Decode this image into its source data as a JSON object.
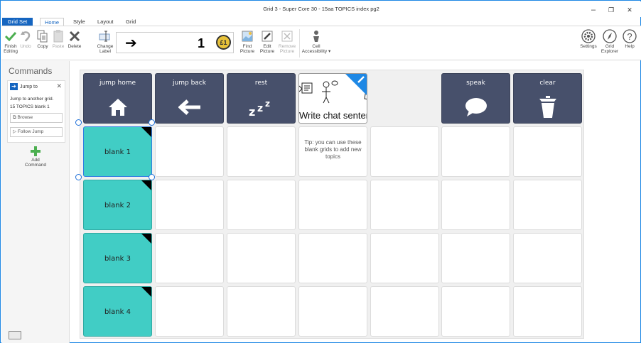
{
  "window": {
    "title": "Grid 3 - Super Core 30 - 15aa TOPICS index pg2",
    "minimize": "–",
    "maximize": "❐",
    "close": "✕"
  },
  "tabs": [
    {
      "label": "Grid Set"
    },
    {
      "label": "Home"
    },
    {
      "label": "Style"
    },
    {
      "label": "Layout"
    },
    {
      "label": "Grid"
    }
  ],
  "ribbon": {
    "finish_line1": "Finish",
    "finish_line2": "Editing",
    "undo": "Undo",
    "copy": "Copy",
    "paste": "Paste",
    "delete": "Delete",
    "change_label_line1": "Change",
    "change_label_line2": "Label",
    "label_preview": {
      "arrow": "➔",
      "number": "1",
      "coin": "£1"
    },
    "find_picture_line1": "Find",
    "find_picture_line2": "Picture",
    "edit_picture_line1": "Edit",
    "edit_picture_line2": "Picture",
    "remove_picture_line1": "Remove",
    "remove_picture_line2": "Picture",
    "cell_access_line1": "Cell",
    "cell_access_line2": "Accessibility ▾",
    "settings": "Settings",
    "grid_explorer_line1": "Grid",
    "grid_explorer_line2": "Explorer",
    "help": "Help"
  },
  "sidebar": {
    "title": "Commands",
    "command": {
      "name": "Jump to",
      "close": "✕",
      "desc": "Jump to another grid.",
      "target": "15 TOPICS blank 1",
      "browse": "Browse",
      "follow": "Follow Jump"
    },
    "add_line1": "Add",
    "add_line2": "Command"
  },
  "grid": {
    "top_row": [
      {
        "label": "jump home",
        "icon": "home-icon"
      },
      {
        "label": "jump back",
        "icon": "arrow-left-icon"
      },
      {
        "label": "rest",
        "icon": "zzz-icon"
      },
      {
        "label": "",
        "icon": "chat-symbols-icon",
        "text": "Write chat sentences here."
      },
      {
        "label": "speak",
        "icon": "speech-bubble-icon"
      },
      {
        "label": "clear",
        "icon": "trash-icon"
      }
    ],
    "blanks": [
      "blank 1",
      "blank 2",
      "blank 3",
      "blank 4"
    ],
    "tip": "Tip: you can use these blank grids to add new topics"
  },
  "colors": {
    "accent": "#1565c0",
    "dark_cell": "#47506b",
    "teal_cell": "#41cdc5"
  }
}
